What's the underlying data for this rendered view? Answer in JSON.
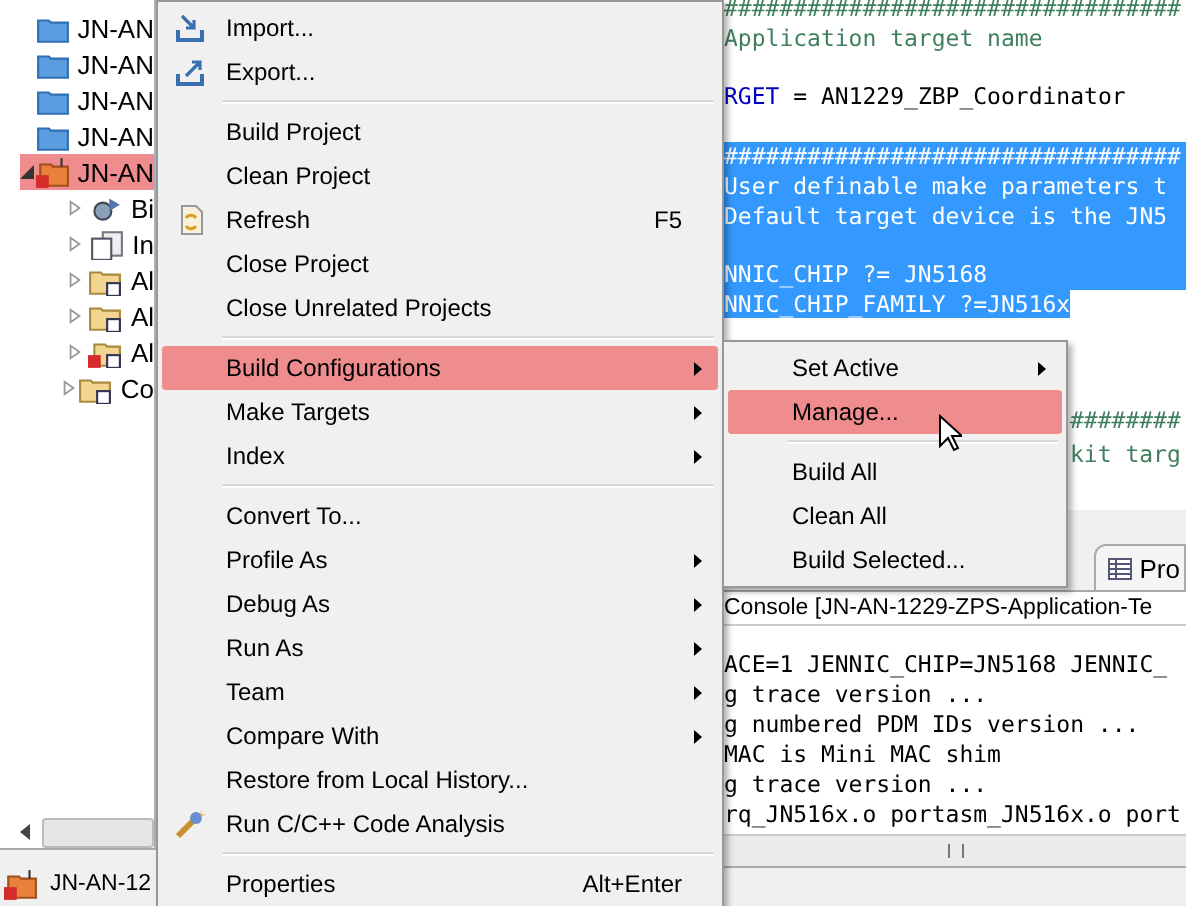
{
  "tree": [
    {
      "label": "JN-AN",
      "kind": "project",
      "selected": false
    },
    {
      "label": "JN-AN",
      "kind": "project",
      "selected": false
    },
    {
      "label": "JN-AN",
      "kind": "project",
      "selected": false
    },
    {
      "label": "JN-AN",
      "kind": "project",
      "selected": false
    },
    {
      "label": "JN-AN",
      "kind": "c-project",
      "selected": true,
      "expanded": true,
      "children": [
        {
          "label": "Bi",
          "kind": "binaries",
          "expanded": false
        },
        {
          "label": "In",
          "kind": "includes",
          "expanded": false
        },
        {
          "label": "Al",
          "kind": "folder",
          "expanded": false
        },
        {
          "label": "Al",
          "kind": "folder",
          "expanded": false
        },
        {
          "label": "Al",
          "kind": "folder-error",
          "expanded": false
        },
        {
          "label": "Co",
          "kind": "folder",
          "expanded": false
        }
      ]
    }
  ],
  "status_bar": {
    "label": "JN-AN-12"
  },
  "editor": {
    "lines": [
      {
        "kind": "comment",
        "text": "#################################",
        "selected": false
      },
      {
        "kind": "comment",
        "text": "Application target name",
        "selected": false
      },
      {
        "kind": "blank",
        "selected": false
      },
      {
        "kind": "assign",
        "name": "RGET",
        "text": " = AN1229_ZBP_Coordinator",
        "selected": false
      },
      {
        "kind": "blank",
        "selected": false
      },
      {
        "kind": "comment",
        "text": "#################################",
        "selected": true
      },
      {
        "kind": "comment",
        "text": "User definable make parameters t",
        "selected": true
      },
      {
        "kind": "comment",
        "text": "Default target device is the JN5",
        "selected": true
      },
      {
        "kind": "blank",
        "selected": true
      },
      {
        "kind": "code",
        "text": "NNIC_CHIP ?= JN5168",
        "selected": true
      },
      {
        "kind": "code",
        "text": "NNIC_CHIP_FAMILY ?=JN516x",
        "selected": true
      }
    ],
    "tail_lines": [
      {
        "kind": "comment",
        "text": "########"
      },
      {
        "kind": "comment",
        "text": "kit targ"
      }
    ]
  },
  "tabs": [
    {
      "label": "Pro"
    }
  ],
  "console": {
    "title": "Console [JN-AN-1229-ZPS-Application-Te",
    "lines": [
      "ACE=1 JENNIC_CHIP=JN5168 JENNIC_",
      "g trace version ...",
      "g numbered PDM IDs version ...",
      "MAC is Mini MAC shim",
      "g trace version ...",
      "rq_JN516x.o portasm_JN516x.o port"
    ]
  },
  "context_menu": {
    "items": [
      {
        "kind": "import",
        "label": "Import...",
        "submenu": false,
        "selected": false
      },
      {
        "kind": "export",
        "label": "Export...",
        "submenu": false,
        "selected": false
      },
      {
        "kind": "separator"
      },
      {
        "kind": "item",
        "label": "Build Project",
        "submenu": false,
        "selected": false
      },
      {
        "kind": "item",
        "label": "Clean Project",
        "submenu": false,
        "selected": false
      },
      {
        "kind": "refresh",
        "label": "Refresh",
        "shortcut": "F5",
        "submenu": false,
        "selected": false
      },
      {
        "kind": "item",
        "label": "Close Project",
        "submenu": false,
        "selected": false
      },
      {
        "kind": "item",
        "label": "Close Unrelated Projects",
        "submenu": false,
        "selected": false
      },
      {
        "kind": "separator"
      },
      {
        "kind": "item",
        "label": "Build Configurations",
        "submenu": true,
        "selected": true
      },
      {
        "kind": "item",
        "label": "Make Targets",
        "submenu": true,
        "selected": false
      },
      {
        "kind": "item",
        "label": "Index",
        "submenu": true,
        "selected": false
      },
      {
        "kind": "separator"
      },
      {
        "kind": "item",
        "label": "Convert To...",
        "submenu": false,
        "selected": false
      },
      {
        "kind": "item",
        "label": "Profile As",
        "submenu": true,
        "selected": false
      },
      {
        "kind": "item",
        "label": "Debug As",
        "submenu": true,
        "selected": false
      },
      {
        "kind": "item",
        "label": "Run As",
        "submenu": true,
        "selected": false
      },
      {
        "kind": "item",
        "label": "Team",
        "submenu": true,
        "selected": false
      },
      {
        "kind": "item",
        "label": "Compare With",
        "submenu": true,
        "selected": false
      },
      {
        "kind": "item",
        "label": "Restore from Local History...",
        "submenu": false,
        "selected": false
      },
      {
        "kind": "analysis",
        "label": "Run C/C++ Code Analysis",
        "submenu": false,
        "selected": false
      },
      {
        "kind": "separator"
      },
      {
        "kind": "item",
        "label": "Properties",
        "shortcut": "Alt+Enter",
        "submenu": false,
        "selected": false
      }
    ]
  },
  "submenu": {
    "items": [
      {
        "kind": "item",
        "label": "Set Active",
        "submenu": true,
        "selected": false
      },
      {
        "kind": "item",
        "label": "Manage...",
        "submenu": false,
        "selected": true
      },
      {
        "kind": "separator"
      },
      {
        "kind": "item",
        "label": "Build All",
        "submenu": false,
        "selected": false
      },
      {
        "kind": "item",
        "label": "Clean All",
        "submenu": false,
        "selected": false
      },
      {
        "kind": "item",
        "label": "Build Selected...",
        "submenu": false,
        "selected": false
      }
    ]
  }
}
